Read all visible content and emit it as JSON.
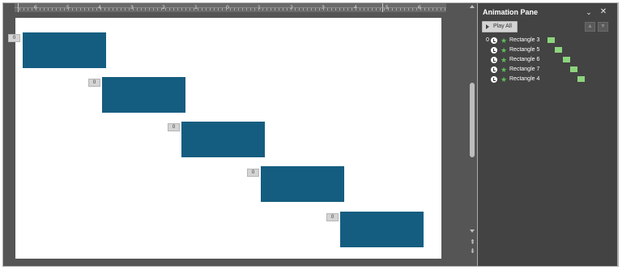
{
  "ruler": {
    "labels": [
      "6",
      "5",
      "4",
      "3",
      "2",
      "1",
      "0",
      "1",
      "2",
      "3",
      "4",
      "5",
      "6"
    ]
  },
  "slide": {
    "shape_color": "#155d80",
    "tags": [
      "0",
      "0",
      "0",
      "0",
      "0"
    ]
  },
  "animation_pane": {
    "title": "Animation Pane",
    "play_all_label": "Play All",
    "collapse_icon": "chevron-down-icon",
    "close_icon": "close-icon",
    "move_up_icon": "arrow-up-icon",
    "move_down_icon": "arrow-down-icon",
    "items": [
      {
        "index": "0",
        "name": "Rectangle 3",
        "trigger_icon": "clock-icon",
        "effect_icon": "star-icon"
      },
      {
        "index": "",
        "name": "Rectangle 5",
        "trigger_icon": "clock-icon",
        "effect_icon": "star-icon"
      },
      {
        "index": "",
        "name": "Rectangle 6",
        "trigger_icon": "clock-icon",
        "effect_icon": "star-icon"
      },
      {
        "index": "",
        "name": "Rectangle 7",
        "trigger_icon": "clock-icon",
        "effect_icon": "star-icon"
      },
      {
        "index": "",
        "name": "Rectangle 4",
        "trigger_icon": "clock-icon",
        "effect_icon": "star-icon"
      }
    ],
    "timeline_bar_color": "#8dd47e"
  }
}
